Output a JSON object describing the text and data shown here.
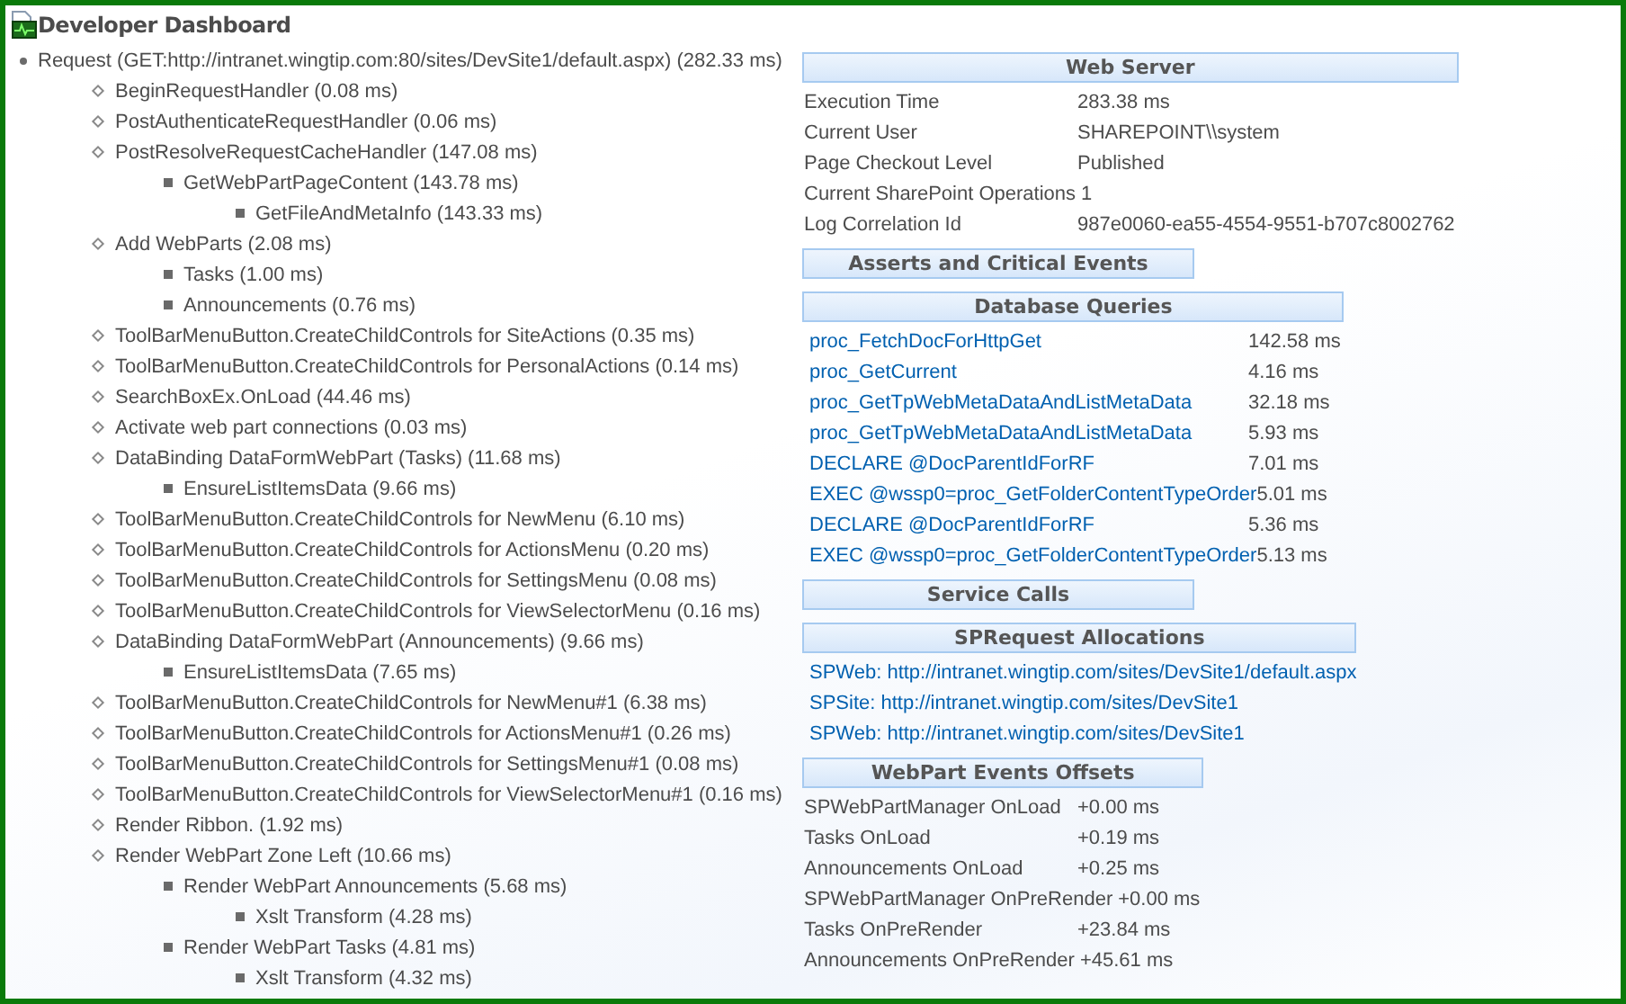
{
  "title": "Developer Dashboard",
  "tree": [
    {
      "text": "Request (GET:http://intranet.wingtip.com:80/sites/DevSite1/default.aspx) (282.33 ms)",
      "children": [
        {
          "text": "BeginRequestHandler (0.08 ms)"
        },
        {
          "text": "PostAuthenticateRequestHandler (0.06 ms)"
        },
        {
          "text": "PostResolveRequestCacheHandler (147.08 ms)",
          "children": [
            {
              "text": "GetWebPartPageContent (143.78 ms)",
              "children": [
                {
                  "text": "GetFileAndMetaInfo (143.33 ms)"
                }
              ]
            }
          ]
        },
        {
          "text": "Add WebParts (2.08 ms)",
          "children": [
            {
              "text": "Tasks (1.00 ms)"
            },
            {
              "text": "Announcements (0.76 ms)"
            }
          ]
        },
        {
          "text": "ToolBarMenuButton.CreateChildControls for SiteActions (0.35 ms)"
        },
        {
          "text": "ToolBarMenuButton.CreateChildControls for PersonalActions (0.14 ms)"
        },
        {
          "text": "SearchBoxEx.OnLoad (44.46 ms)"
        },
        {
          "text": "Activate web part connections (0.03 ms)"
        },
        {
          "text": "DataBinding DataFormWebPart (Tasks) (11.68 ms)",
          "children": [
            {
              "text": "EnsureListItemsData (9.66 ms)"
            }
          ]
        },
        {
          "text": "ToolBarMenuButton.CreateChildControls for NewMenu (6.10 ms)"
        },
        {
          "text": "ToolBarMenuButton.CreateChildControls for ActionsMenu (0.20 ms)"
        },
        {
          "text": "ToolBarMenuButton.CreateChildControls for SettingsMenu (0.08 ms)"
        },
        {
          "text": "ToolBarMenuButton.CreateChildControls for ViewSelectorMenu (0.16 ms)"
        },
        {
          "text": "DataBinding DataFormWebPart (Announcements) (9.66 ms)",
          "children": [
            {
              "text": "EnsureListItemsData (7.65 ms)"
            }
          ]
        },
        {
          "text": "ToolBarMenuButton.CreateChildControls for NewMenu#1 (6.38 ms)"
        },
        {
          "text": "ToolBarMenuButton.CreateChildControls for ActionsMenu#1 (0.26 ms)"
        },
        {
          "text": "ToolBarMenuButton.CreateChildControls for SettingsMenu#1 (0.08 ms)"
        },
        {
          "text": "ToolBarMenuButton.CreateChildControls for ViewSelectorMenu#1 (0.16 ms)"
        },
        {
          "text": "Render Ribbon. (1.92 ms)"
        },
        {
          "text": "Render WebPart Zone Left (10.66 ms)",
          "children": [
            {
              "text": "Render WebPart Announcements (5.68 ms)",
              "children": [
                {
                  "text": "Xslt Transform (4.28 ms)"
                }
              ]
            },
            {
              "text": "Render WebPart Tasks (4.81 ms)",
              "children": [
                {
                  "text": "Xslt Transform (4.32 ms)"
                }
              ]
            }
          ]
        }
      ]
    }
  ],
  "sections": [
    {
      "title": "Web Server",
      "kind": "info",
      "rows": [
        {
          "label": "Execution Time",
          "value": "283.38 ms"
        },
        {
          "label": "Current User",
          "value": "SHAREPOINT\\\\system"
        },
        {
          "label": "Page Checkout Level",
          "value": "Published"
        },
        {
          "label": "Current SharePoint Operations",
          "value": "1"
        },
        {
          "label": "Log Correlation Id",
          "value": "987e0060-ea55-4554-9551-b707c8002762"
        }
      ]
    },
    {
      "title": "Asserts and Critical Events",
      "kind": "info"
    },
    {
      "title": "Database Queries",
      "kind": "links",
      "rows": [
        {
          "label": "proc_FetchDocForHttpGet",
          "value": "142.58 ms"
        },
        {
          "label": "proc_GetCurrent",
          "value": "4.16 ms"
        },
        {
          "label": "proc_GetTpWebMetaDataAndListMetaData",
          "value": "32.18 ms"
        },
        {
          "label": "proc_GetTpWebMetaDataAndListMetaData",
          "value": "5.93 ms"
        },
        {
          "label": "DECLARE @DocParentIdForRF",
          "value": "7.01 ms"
        },
        {
          "label": "EXEC @wssp0=proc_GetFolderContentTypeOrder",
          "value": "5.01 ms"
        },
        {
          "label": "DECLARE @DocParentIdForRF",
          "value": "5.36 ms"
        },
        {
          "label": "EXEC @wssp0=proc_GetFolderContentTypeOrder",
          "value": "5.13 ms"
        }
      ]
    },
    {
      "title": "Service Calls",
      "kind": "info"
    },
    {
      "title": "SPRequest Allocations",
      "kind": "links",
      "rows": [
        {
          "label": "SPWeb: http://intranet.wingtip.com/sites/DevSite1/default.aspx"
        },
        {
          "label": "SPSite: http://intranet.wingtip.com/sites/DevSite1"
        },
        {
          "label": "SPWeb: http://intranet.wingtip.com/sites/DevSite1"
        }
      ]
    },
    {
      "title": "WebPart Events Offsets",
      "kind": "info",
      "rows": [
        {
          "label": "SPWebPartManager OnLoad",
          "value": "+0.00 ms"
        },
        {
          "label": "Tasks OnLoad",
          "value": "+0.19 ms"
        },
        {
          "label": "Announcements OnLoad",
          "value": "+0.25 ms"
        },
        {
          "label": "SPWebPartManager OnPreRender",
          "value": "+0.00 ms"
        },
        {
          "label": "Tasks OnPreRender",
          "value": "+23.84 ms"
        },
        {
          "label": "Announcements OnPreRender",
          "value": "+45.61 ms"
        }
      ]
    }
  ]
}
